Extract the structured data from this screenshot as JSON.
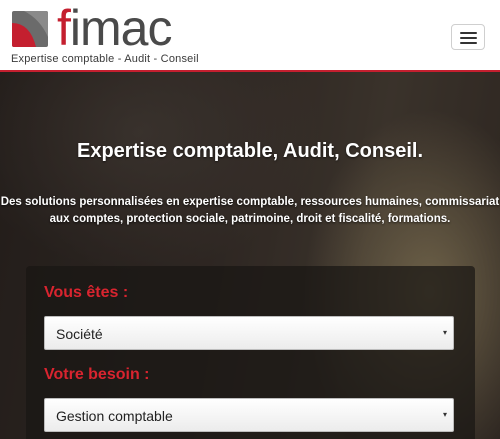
{
  "header": {
    "brand_f": "f",
    "brand_rest": "imac",
    "tagline": "Expertise comptable - Audit - Conseil",
    "accent_color": "#c41f2f"
  },
  "hero": {
    "title": "Expertise comptable, Audit, Conseil.",
    "text_line1": "Des solutions personnalisées en expertise comptable, ressources humaines, commissariat",
    "text_line2": "aux comptes, protection sociale, patrimoine, droit et fiscalité, formations."
  },
  "form": {
    "label_vous_etes": "Vous êtes :",
    "value_vous_etes": "Société",
    "label_besoin": "Votre besoin :",
    "value_besoin": "Gestion comptable",
    "caret_icon": "▾"
  }
}
